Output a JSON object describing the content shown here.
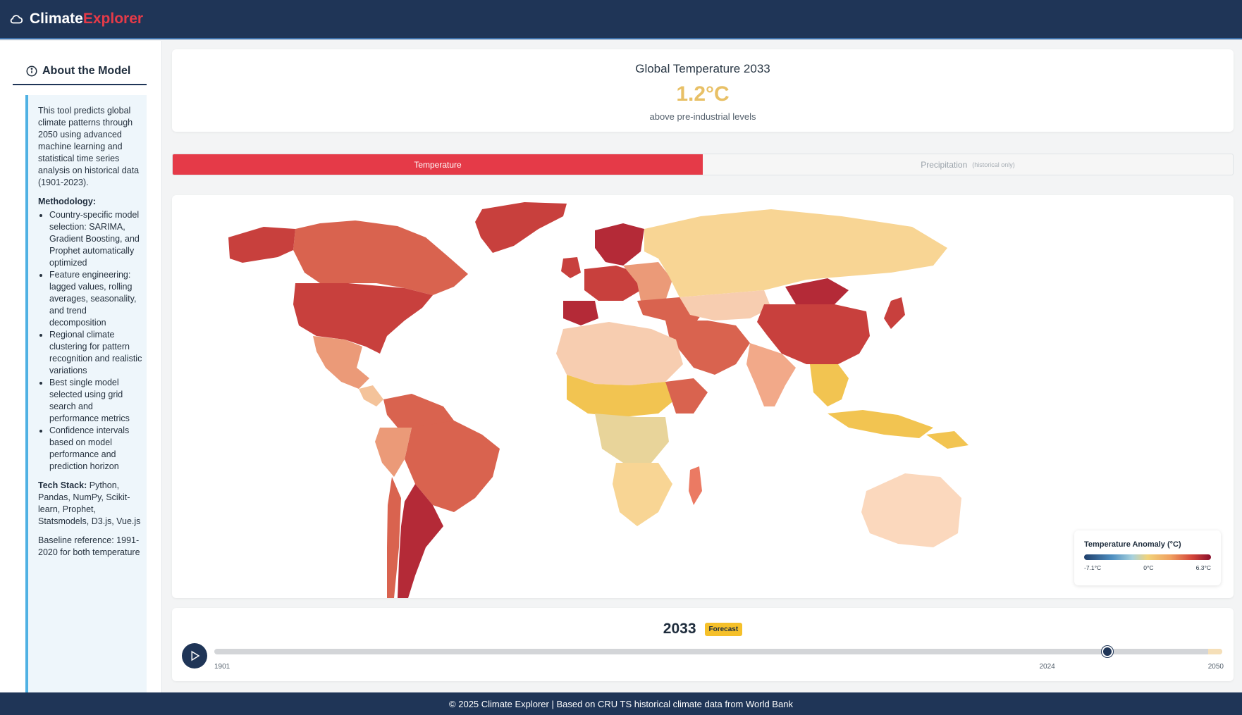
{
  "header": {
    "brand_primary": "Climate",
    "brand_accent": "Explorer",
    "brand_icon": "cloud-icon"
  },
  "sidebar": {
    "title": "About the Model",
    "title_icon": "info-icon",
    "intro": "This tool predicts global climate patterns through 2050 using advanced machine learning and statistical time series analysis on historical data (1901-2023).",
    "methodology_title": "Methodology:",
    "methodology_items": [
      "Country-specific model selection: SARIMA, Gradient Boosting, and Prophet automatically optimized",
      "Feature engineering: lagged values, rolling averages, seasonality, and trend decomposition",
      "Regional climate clustering for pattern recognition and realistic variations",
      "Best single model selected using grid search and performance metrics",
      "Confidence intervals based on model performance and prediction horizon"
    ],
    "tech_stack_label": "Tech Stack:",
    "tech_stack": "Python, Pandas, NumPy, Scikit-learn, Prophet, Statsmodels, D3.js, Vue.js",
    "baseline": "Baseline reference: 1991-2020 for both temperature"
  },
  "summary": {
    "title": "Global Temperature 2033",
    "value": "1.2°C",
    "subtitle": "above pre-industrial levels"
  },
  "tabs": [
    {
      "label": "Temperature",
      "note": "",
      "active": true
    },
    {
      "label": "Precipitation",
      "note": "(historical only)",
      "active": false
    }
  ],
  "legend": {
    "title": "Temperature Anomaly (°C)",
    "min_label": "-7.1°C",
    "mid_label": "0°C",
    "max_label": "6.3°C"
  },
  "timeline": {
    "year": "2033",
    "badge": "Forecast",
    "start_label": "1901",
    "mid_label": "2024",
    "end_label": "2050",
    "start_year": 1901,
    "current_year": 2033,
    "forecast_start_year": 2024,
    "end_year": 2050
  },
  "footer": {
    "text": "© 2025 Climate Explorer | Based on CRU TS historical climate data from World Bank"
  },
  "colors": {
    "header_bg": "#1f3557",
    "accent_red": "#e53a48",
    "value_gold": "#e8c066",
    "forecast_badge": "#f5c02a"
  }
}
